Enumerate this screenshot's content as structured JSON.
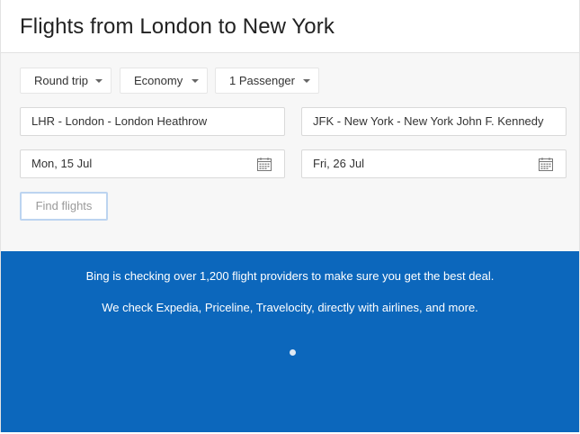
{
  "header": {
    "title": "Flights from London to New York"
  },
  "search": {
    "trip_type": "Round trip",
    "cabin_class": "Economy",
    "passengers": "1 Passenger",
    "origin": "LHR - London - London Heathrow",
    "destination": "JFK - New York - New York John F. Kennedy",
    "depart_date": "Mon, 15 Jul",
    "return_date": "Fri, 26 Jul",
    "find_label": "Find flights"
  },
  "banner": {
    "line1": "Bing is checking over 1,200 flight providers to make sure you get the best deal.",
    "line2": "We check Expedia, Priceline, Travelocity, directly with airlines, and more."
  },
  "icons": {
    "dropdown": "chevron-down-icon",
    "date": "calendar-icon",
    "loading": "spinner-icon"
  },
  "colors": {
    "banner_bg": "#0c67bc",
    "button_border": "#bcd4f0"
  }
}
